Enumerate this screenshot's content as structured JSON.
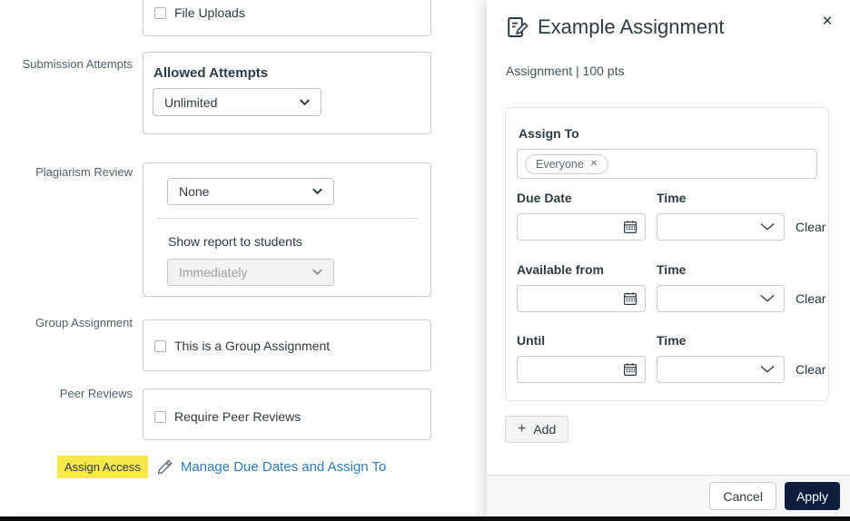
{
  "left_panel": {
    "file_uploads": {
      "checkbox_label": "File Uploads"
    },
    "submission_attempts": {
      "row_label": "Submission Attempts",
      "heading": "Allowed Attempts",
      "select_value": "Unlimited"
    },
    "plagiarism_review": {
      "row_label": "Plagiarism Review",
      "select_value": "None",
      "show_report_label": "Show report to students",
      "report_select_value": "Immediately"
    },
    "group_assignment": {
      "row_label": "Group Assignment",
      "checkbox_label": "This is a Group Assignment"
    },
    "peer_reviews": {
      "row_label": "Peer Reviews",
      "checkbox_label": "Require Peer Reviews"
    },
    "assign_access": {
      "row_label": "Assign Access",
      "link_label": "Manage Due Dates and Assign To"
    }
  },
  "tray": {
    "title": "Example Assignment",
    "subtitle": "Assignment | 100 pts",
    "card": {
      "assign_to_label": "Assign To",
      "selected_tag": "Everyone",
      "rows": [
        {
          "date_label": "Due Date",
          "time_label": "Time",
          "clear_label": "Clear"
        },
        {
          "date_label": "Available from",
          "time_label": "Time",
          "clear_label": "Clear"
        },
        {
          "date_label": "Until",
          "time_label": "Time",
          "clear_label": "Clear"
        }
      ]
    },
    "add_button_label": "Add",
    "footer": {
      "cancel_label": "Cancel",
      "apply_label": "Apply"
    }
  },
  "icons": {
    "close": "✕",
    "pill_remove": "✕",
    "add_plus": "+"
  },
  "colors": {
    "text": "#2D3B45",
    "muted": "#52606A",
    "border": "#C7CDD1",
    "link": "#2D7CC1",
    "highlight": "#F7E84B",
    "apply": "#0F1E3E",
    "footer": "#F7F8F8"
  }
}
